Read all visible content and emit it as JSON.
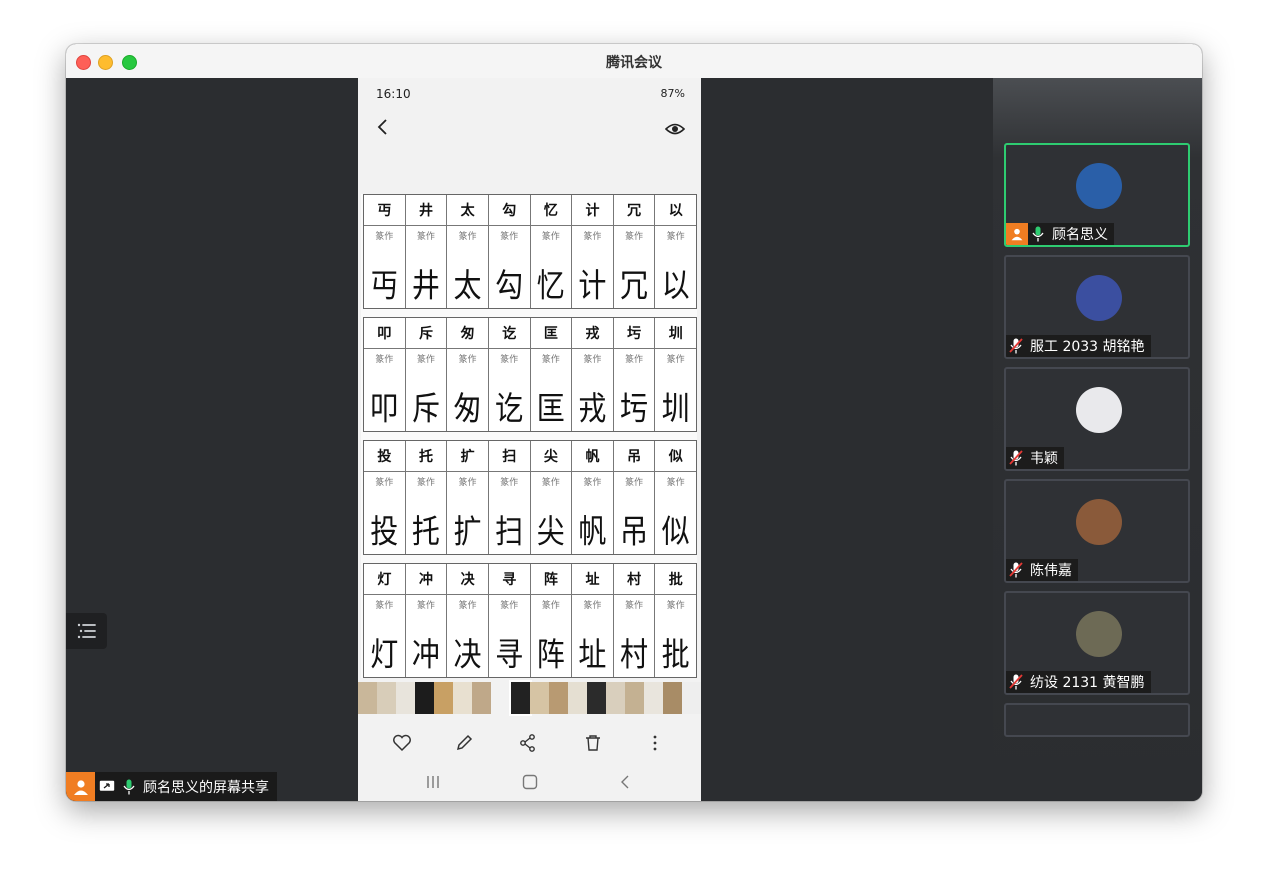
{
  "window": {
    "title": "腾讯会议"
  },
  "share": {
    "label": "顾名思义的屏幕共享"
  },
  "phone": {
    "status_time": "16:10",
    "status_right": "87%",
    "rows": [
      {
        "heads": [
          "丏",
          "井",
          "太",
          "勾",
          "忆",
          "计",
          "冗",
          "以"
        ],
        "zh": "篆作",
        "seals": [
          "丏",
          "井",
          "太",
          "勾",
          "忆",
          "计",
          "冗",
          "以"
        ]
      },
      {
        "heads": [
          "叩",
          "斥",
          "匆",
          "讫",
          "匡",
          "戎",
          "圬",
          "圳"
        ],
        "zh": "篆作",
        "seals": [
          "叩",
          "斥",
          "匆",
          "讫",
          "匡",
          "戎",
          "圬",
          "圳"
        ]
      },
      {
        "heads": [
          "投",
          "托",
          "扩",
          "扫",
          "尖",
          "帆",
          "吊",
          "似"
        ],
        "zh": "篆作",
        "seals": [
          "投",
          "托",
          "扩",
          "扫",
          "尖",
          "帆",
          "吊",
          "似"
        ]
      },
      {
        "heads": [
          "灯",
          "冲",
          "决",
          "寻",
          "阵",
          "址",
          "村",
          "批"
        ],
        "zh": "篆作",
        "seals": [
          "灯",
          "冲",
          "决",
          "寻",
          "阵",
          "址",
          "村",
          "批"
        ]
      }
    ],
    "thumb_colors": [
      "#c9b79a",
      "#d8cdb9",
      "#e8e4dc",
      "#1c1c1c",
      "#c8a064",
      "#e8e0d0",
      "#bfa889",
      "#f2f2f2",
      "#222222",
      "#d6c4a4",
      "#b89a72",
      "#e5dfd2",
      "#2b2b2b",
      "#d9cfbd",
      "#c4b192",
      "#e9e5dd",
      "#a88c66",
      "#eeeeee"
    ]
  },
  "participants": [
    {
      "name": "顾名思义",
      "active": true,
      "host": true,
      "muted": false,
      "avatar_color": "#2a5fa8"
    },
    {
      "name": "服工 2033 胡铭艳",
      "active": false,
      "host": false,
      "muted": true,
      "avatar_color": "#3b4fa0"
    },
    {
      "name": "韦颖",
      "active": false,
      "host": false,
      "muted": true,
      "avatar_color": "#e9e9ec"
    },
    {
      "name": "陈伟嘉",
      "active": false,
      "host": false,
      "muted": true,
      "avatar_color": "#8a5a3a"
    },
    {
      "name": "纺设 2131 黄智鹏",
      "active": false,
      "host": false,
      "muted": true,
      "avatar_color": "#6d6a55"
    }
  ],
  "colors": {
    "accent_green": "#2ecc71",
    "host_orange": "#f07d22",
    "mic_green": "#2ecc71",
    "mute_red": "#e53935"
  },
  "icons": [
    "list-icon",
    "screen-share-icon",
    "mic-icon",
    "mic-off-icon",
    "person-icon",
    "back-icon",
    "eye-icon",
    "heart-icon",
    "edit-icon",
    "share-icon",
    "trash-icon",
    "more-icon"
  ]
}
